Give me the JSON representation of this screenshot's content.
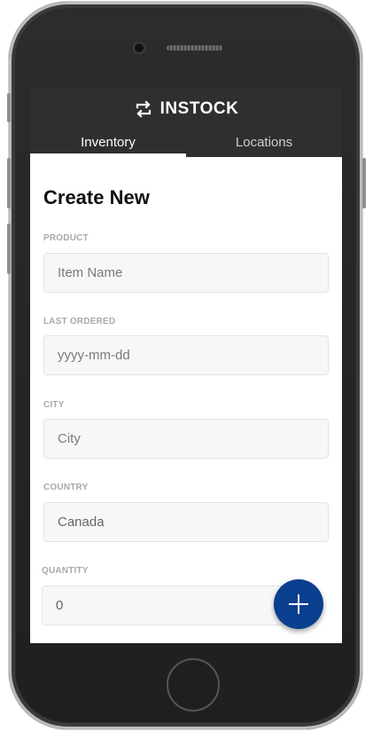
{
  "app": {
    "brand_name": "INSTOCK",
    "brand_icon": "sync-icon"
  },
  "tabs": [
    {
      "label": "Inventory",
      "active": true
    },
    {
      "label": "Locations",
      "active": false
    }
  ],
  "form": {
    "title": "Create New",
    "fields": [
      {
        "label": "PRODUCT",
        "placeholder": "Item Name",
        "value": ""
      },
      {
        "label": "LAST ORDERED",
        "placeholder": "yyyy-mm-dd",
        "value": ""
      },
      {
        "label": "CITY",
        "placeholder": "City",
        "value": ""
      },
      {
        "label": "COUNTRY",
        "placeholder": "",
        "value": "Canada"
      },
      {
        "label": "QUANTITY",
        "placeholder": "",
        "value": "0"
      }
    ]
  },
  "fab": {
    "icon": "plus-icon"
  },
  "colors": {
    "header_bg": "#2f2f2f",
    "fab_bg": "#0b3f8f",
    "label": "#a9a9a9",
    "input_bg": "#f7f7f7"
  }
}
